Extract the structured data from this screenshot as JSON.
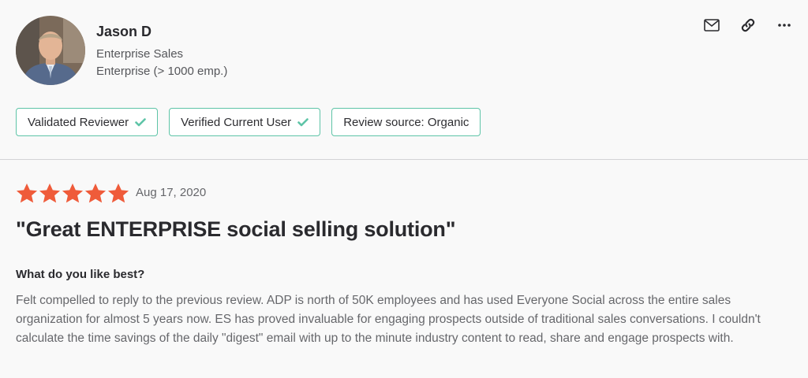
{
  "reviewer": {
    "name": "Jason D",
    "role": "Enterprise Sales",
    "company_size": "Enterprise (> 1000 emp.)"
  },
  "badges": [
    {
      "label": "Validated Reviewer",
      "checked": true
    },
    {
      "label": "Verified Current User",
      "checked": true
    },
    {
      "label": "Review source: Organic",
      "checked": false
    }
  ],
  "actions": [
    "mail-icon",
    "link-icon",
    "more-icon"
  ],
  "review": {
    "rating": 5,
    "rating_max": 5,
    "date": "Aug 17, 2020",
    "title": "\"Great ENTERPRISE social selling solution\"",
    "question": "What do you like best?",
    "answer": "Felt compelled to reply to the previous review. ADP is north of 50K employees and has used Everyone Social across the entire sales organization for almost 5 years now. ES has proved invaluable for engaging prospects outside of traditional sales conversations. I couldn't calculate the time savings of the daily \"digest\" email with up to the minute industry content to read, share and engage prospects with."
  },
  "colors": {
    "star": "#ef5b3a",
    "badge_border": "#5ec4a7",
    "check": "#5ec4a7"
  }
}
